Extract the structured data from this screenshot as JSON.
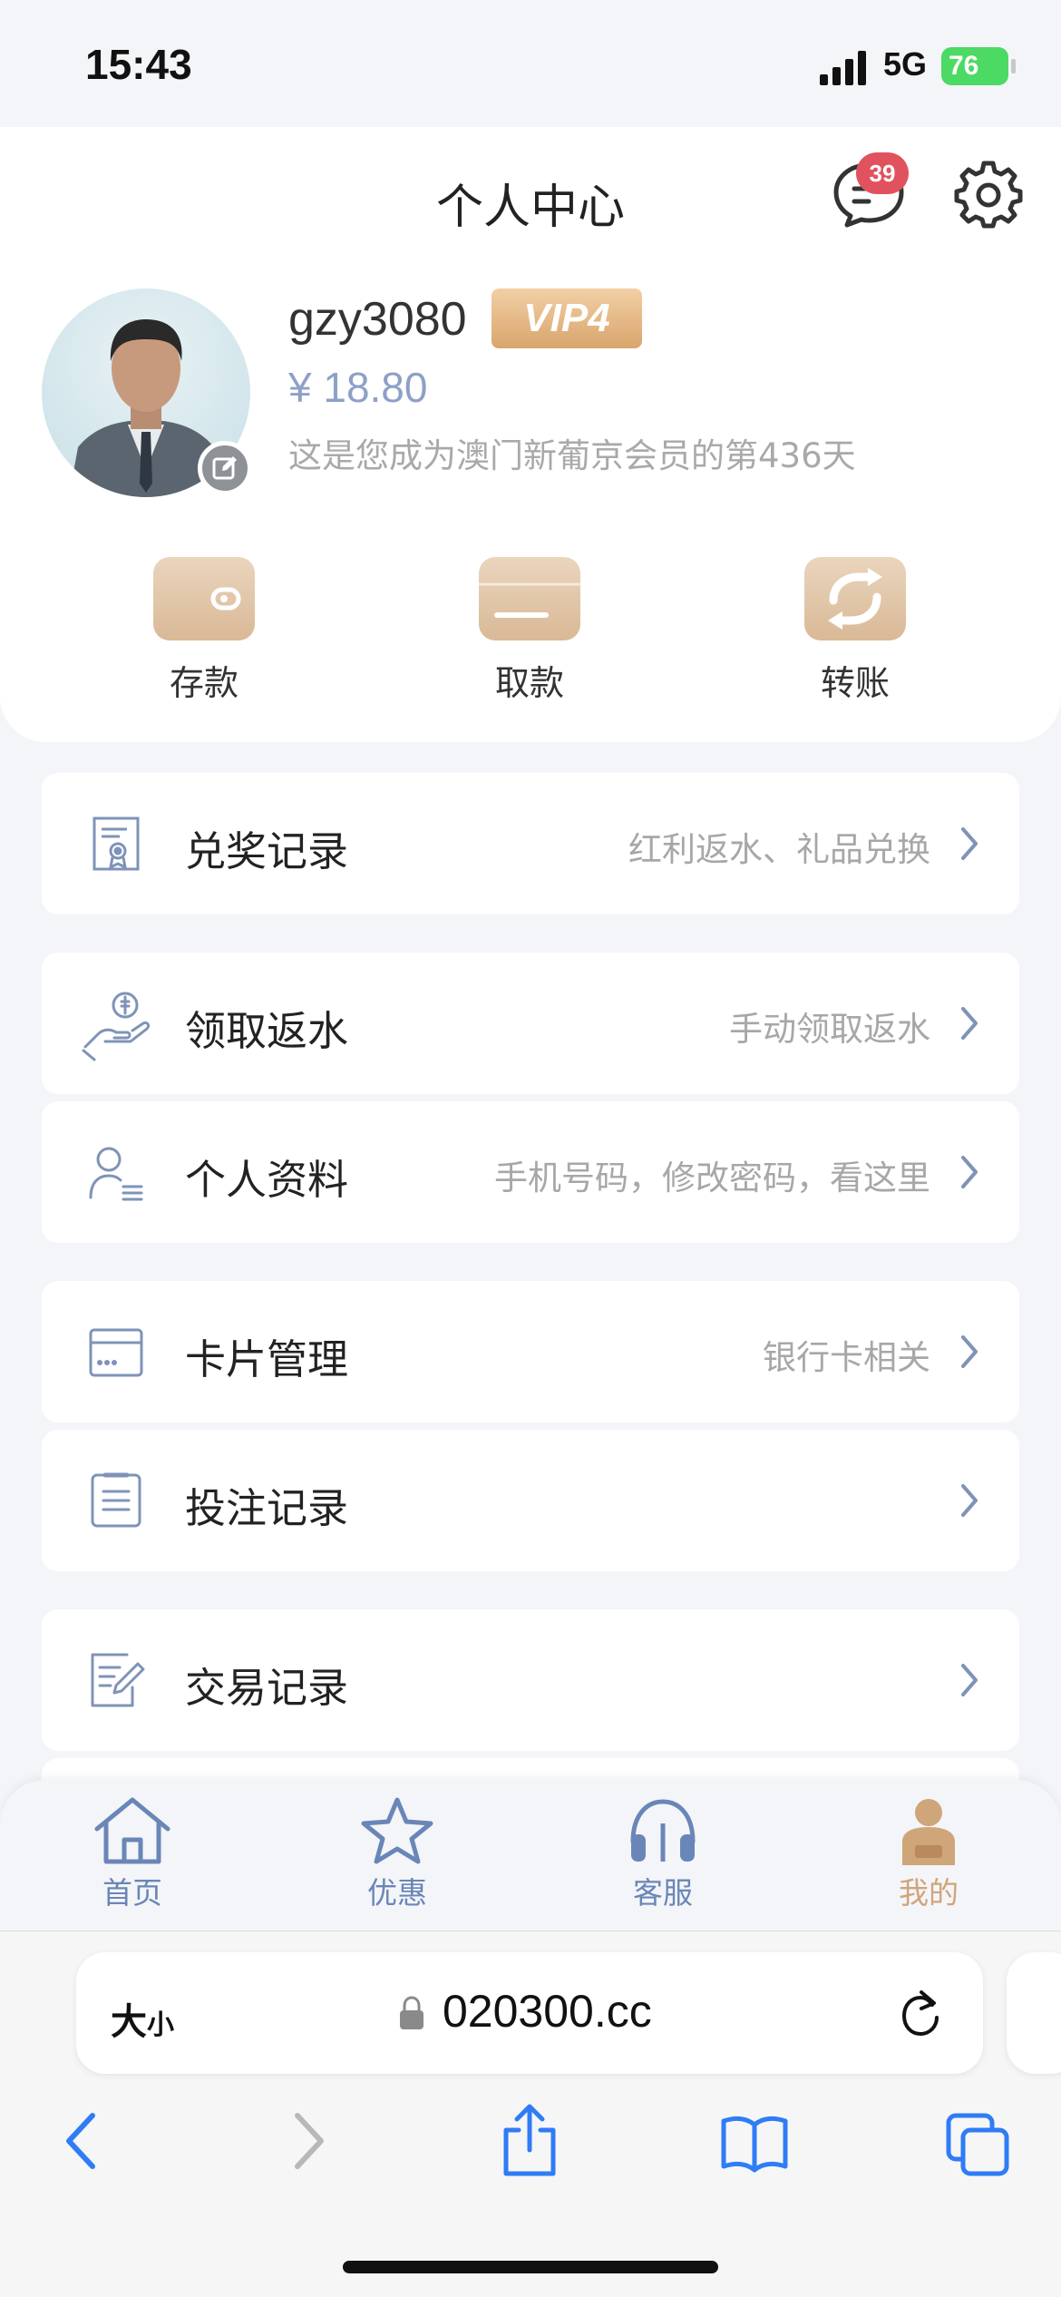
{
  "status_bar": {
    "time": "15:43",
    "network": "5G",
    "battery": "76"
  },
  "header": {
    "title": "个人中心",
    "message_badge": "39"
  },
  "profile": {
    "username": "gzy3080",
    "vip_level": "VIP4",
    "balance": "¥ 18.80",
    "member_days_text": "这是您成为澳门新葡京会员的第436天"
  },
  "actions": [
    {
      "label": "存款",
      "icon": "wallet-icon"
    },
    {
      "label": "取款",
      "icon": "card-icon"
    },
    {
      "label": "转账",
      "icon": "transfer-icon"
    }
  ],
  "menu": [
    {
      "label": "兑奖记录",
      "desc": "红利返水、礼品兑换",
      "icon": "certificate-icon"
    },
    {
      "label": "领取返水",
      "desc": "手动领取返水",
      "icon": "hand-coin-icon"
    },
    {
      "label": "个人资料",
      "desc": "手机号码，修改密码，看这里",
      "icon": "user-profile-icon"
    },
    {
      "label": "卡片管理",
      "desc": "银行卡相关",
      "icon": "bank-card-icon"
    },
    {
      "label": "投注记录",
      "desc": "",
      "icon": "document-list-icon"
    },
    {
      "label": "交易记录",
      "desc": "",
      "icon": "edit-document-icon"
    }
  ],
  "tabbar": {
    "items": [
      {
        "label": "首页",
        "icon": "home-icon"
      },
      {
        "label": "优惠",
        "icon": "star-icon"
      },
      {
        "label": "客服",
        "icon": "headset-icon"
      },
      {
        "label": "我的",
        "icon": "person-icon",
        "active": true
      }
    ]
  },
  "browser": {
    "text_size_label_big": "大",
    "text_size_label_small": "小",
    "url": "020300.cc"
  },
  "colors": {
    "accent_gold": "#d9a56d",
    "icon_blue": "#7f93b8",
    "active_tab": "#cfa57a",
    "badge_red": "#e0535e"
  }
}
